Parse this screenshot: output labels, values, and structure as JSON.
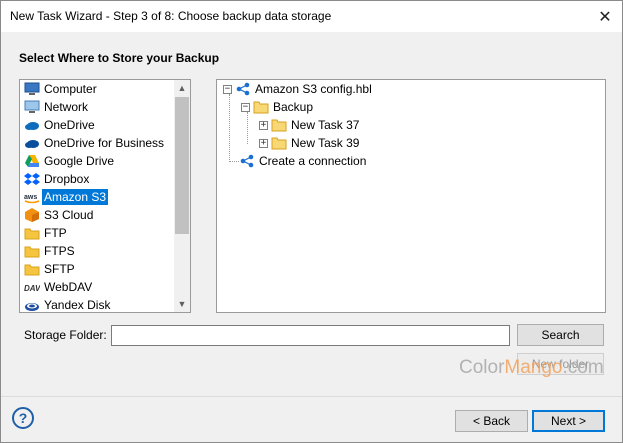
{
  "window": {
    "title": "New Task Wizard - Step 3 of 8: Choose backup data storage",
    "close_glyph": "✕"
  },
  "heading": "Select Where to Store your Backup",
  "storage_list": {
    "items": [
      {
        "label": "Computer",
        "icon": "computer-icon"
      },
      {
        "label": "Network",
        "icon": "network-icon"
      },
      {
        "label": "OneDrive",
        "icon": "onedrive-icon"
      },
      {
        "label": "OneDrive for Business",
        "icon": "onedrive-business-icon"
      },
      {
        "label": "Google Drive",
        "icon": "google-drive-icon"
      },
      {
        "label": "Dropbox",
        "icon": "dropbox-icon"
      },
      {
        "label": "Amazon S3",
        "icon": "aws-icon",
        "selected": true
      },
      {
        "label": "S3 Cloud",
        "icon": "s3-cloud-icon"
      },
      {
        "label": "FTP",
        "icon": "ftp-folder-icon"
      },
      {
        "label": "FTPS",
        "icon": "ftps-folder-icon"
      },
      {
        "label": "SFTP",
        "icon": "sftp-folder-icon"
      },
      {
        "label": "WebDAV",
        "icon": "webdav-icon"
      },
      {
        "label": "Yandex Disk",
        "icon": "yandex-disk-icon"
      }
    ],
    "scroll_up": "▲",
    "scroll_down": "▼"
  },
  "tree": {
    "root": {
      "label": "Amazon S3 config.hbl",
      "expander": "−"
    },
    "backup": {
      "label": "Backup",
      "expander": "−"
    },
    "children": [
      {
        "label": "New Task 37",
        "expander": "+"
      },
      {
        "label": "New Task 39",
        "expander": "+"
      }
    ],
    "create": {
      "label": "Create a connection"
    }
  },
  "storage_folder": {
    "label": "Storage Folder:",
    "value": "",
    "search_button": "Search",
    "new_folder_button": "New folder"
  },
  "watermark": {
    "part1": "Color",
    "part2": "Mango",
    "part3": ".com"
  },
  "footer": {
    "help_glyph": "?",
    "back_button": "< Back",
    "next_button": "Next >"
  },
  "colors": {
    "selection": "#0078d7",
    "share_icon": "#1a6fd0",
    "folder": "#f5c542"
  }
}
